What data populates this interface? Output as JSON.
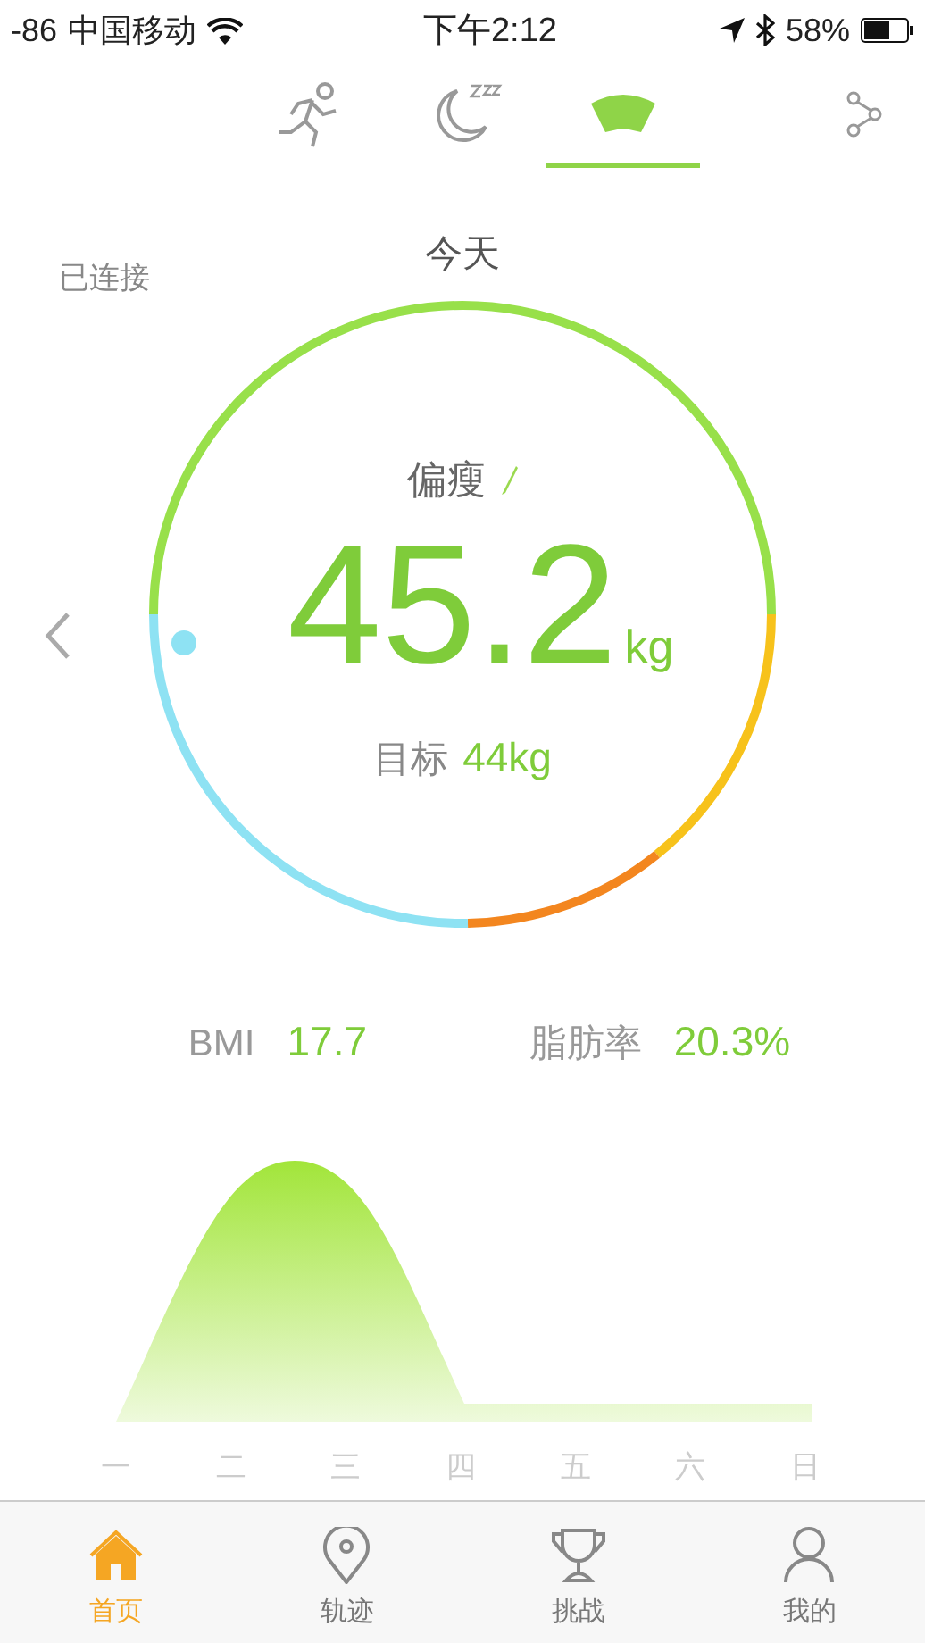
{
  "status_bar": {
    "signal": "-86",
    "carrier": "中国移动",
    "time": "下午2:12",
    "battery": "58%"
  },
  "top_tabs": [
    {
      "kind": "run",
      "selected": false
    },
    {
      "kind": "sleep",
      "selected": false
    },
    {
      "kind": "scale",
      "selected": true
    }
  ],
  "connection": "已连接",
  "date": "今天",
  "gauge": {
    "status": "偏瘦",
    "weight": "45.2",
    "unit": "kg",
    "goal_label": "目标",
    "goal": "44kg"
  },
  "stats": [
    {
      "label": "BMI",
      "value": "17.7"
    },
    {
      "label": "脂肪率",
      "value": "20.3%"
    }
  ],
  "chart": {
    "days": [
      "一",
      "二",
      "三",
      "四",
      "五",
      "六",
      "日"
    ]
  },
  "bottom_tabs": [
    {
      "kind": "home",
      "label": "首页",
      "selected": true
    },
    {
      "kind": "track",
      "label": "轨迹",
      "selected": false
    },
    {
      "kind": "challenge",
      "label": "挑战",
      "selected": false
    },
    {
      "kind": "me",
      "label": "我的",
      "selected": false
    }
  ]
}
